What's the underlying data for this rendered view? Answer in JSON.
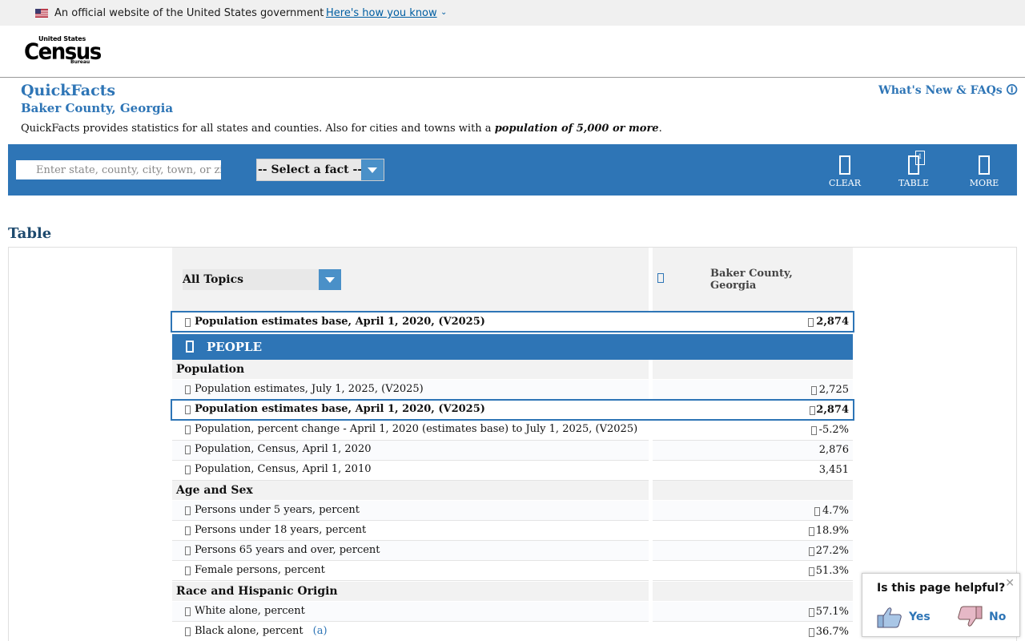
{
  "gov_banner": {
    "text": "An official website of the United States government",
    "link": "Here's how you know"
  },
  "logo": {
    "line1": "United States",
    "line2": "Census",
    "line3": "Bureau"
  },
  "page": {
    "title": "QuickFacts",
    "location": "Baker County, Georgia",
    "desc_pre": "QuickFacts provides statistics for all states and counties. Also for cities and towns with a ",
    "desc_em": "population of 5,000 or more",
    "desc_post": ".",
    "whats_new": "What's New & FAQs 🛈"
  },
  "search": {
    "placeholder": "Enter state, county, city, town, or zip code",
    "fact_select": "-- Select a fact --",
    "tools": {
      "clear": "CLEAR",
      "table": "TABLE",
      "table_badge": "1",
      "more": "MORE"
    }
  },
  "table": {
    "heading": "Table",
    "topics_select": "All Topics",
    "column_location": "Baker County, Georgia",
    "pinned": {
      "label": "Population estimates base, April 1, 2020, (V2025)",
      "value": "2,874"
    },
    "people_label": "PEOPLE",
    "sections": [
      {
        "name": "Population"
      },
      {
        "name": "Age and Sex"
      },
      {
        "name": "Race and Hispanic Origin"
      }
    ],
    "rows": [
      {
        "label": "Population estimates, July 1, 2025, (V2025)",
        "value": "2,725"
      },
      {
        "label": "Population estimates base, April 1, 2020, (V2025)",
        "value": "2,874"
      },
      {
        "label": "Population, percent change - April 1, 2020 (estimates base) to July 1, 2025, (V2025)",
        "value": "-5.2%"
      },
      {
        "label": "Population, Census, April 1, 2020",
        "value": "2,876"
      },
      {
        "label": "Population, Census, April 1, 2010",
        "value": "3,451"
      },
      {
        "label": "Persons under 5 years, percent",
        "value": "4.7%"
      },
      {
        "label": "Persons under 18 years, percent",
        "value": "18.9%"
      },
      {
        "label": "Persons 65 years and over, percent",
        "value": "27.2%"
      },
      {
        "label": "Female persons, percent",
        "value": "51.3%"
      },
      {
        "label": "White alone, percent",
        "value": "57.1%"
      },
      {
        "label": "Black alone, percent",
        "value": "36.7%",
        "footnote": "(a)"
      }
    ]
  },
  "feedback": {
    "question": "Is this page helpful?",
    "yes": "Yes",
    "no": "No",
    "close": "✕"
  }
}
